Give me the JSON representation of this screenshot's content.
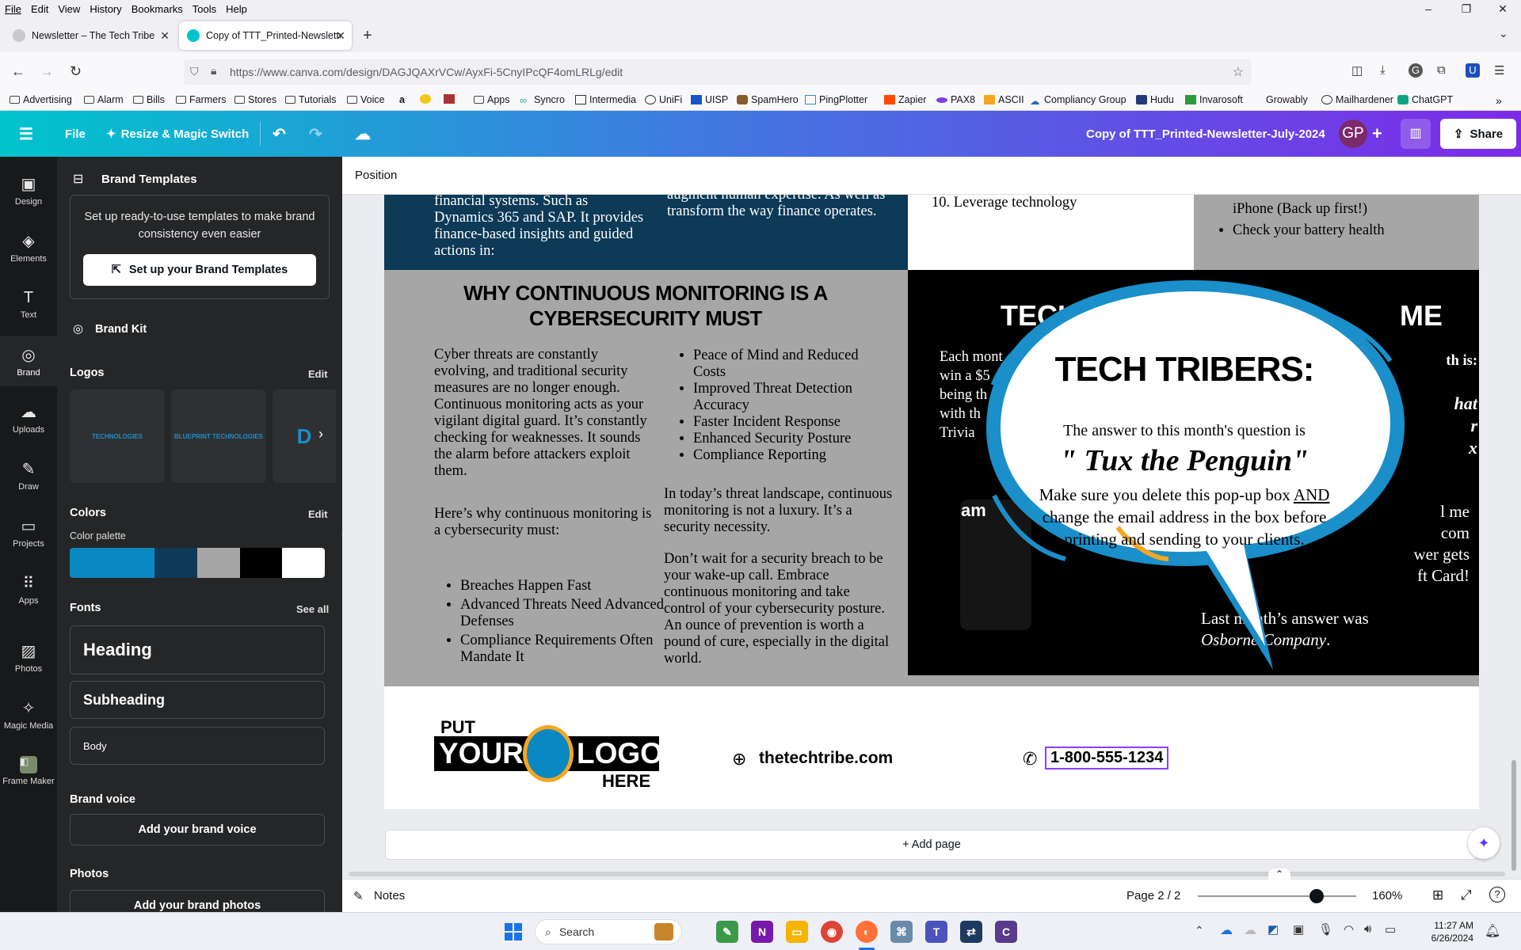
{
  "menu": [
    "File",
    "Edit",
    "View",
    "History",
    "Bookmarks",
    "Tools",
    "Help"
  ],
  "window_controls": {
    "minimize": "–",
    "restore": "❐",
    "close": "✕"
  },
  "tabs": [
    {
      "title": "Newsletter – The Tech Tribe",
      "active": false
    },
    {
      "title": "Copy of TTT_Printed-Newslette",
      "active": true
    }
  ],
  "new_tab": "+",
  "url": "https://www.canva.com/design/DAGJQAXrVCw/AyxFi-5CnyIPcQF4omLRLg/edit",
  "bookmarks": [
    "Advertising",
    "Alarm",
    "Bills",
    "Farmers",
    "Stores",
    "Tutorials",
    "Voice",
    "Apps",
    "Syncro",
    "Intermedia",
    "UniFi",
    "UISP",
    "SpamHero",
    "PingPlotter",
    "Zapier",
    "PAX8",
    "ASCII",
    "Compliancy Group",
    "Hudu",
    "Invarosoft",
    "Growably",
    "Mailhardener",
    "ChatGPT"
  ],
  "canva_header": {
    "file": "File",
    "resize": "Resize & Magic Switch",
    "doc_title": "Copy of  TTT_Printed-Newsletter-July-2024",
    "avatar": "GP",
    "share": "Share"
  },
  "rail": [
    {
      "label": "Design",
      "icon": "design-icon"
    },
    {
      "label": "Elements",
      "icon": "elements-icon"
    },
    {
      "label": "Text",
      "icon": "text-icon"
    },
    {
      "label": "Brand",
      "icon": "brand-icon"
    },
    {
      "label": "Uploads",
      "icon": "uploads-icon"
    },
    {
      "label": "Draw",
      "icon": "draw-icon"
    },
    {
      "label": "Projects",
      "icon": "projects-icon"
    },
    {
      "label": "Apps",
      "icon": "apps-icon"
    },
    {
      "label": "Photos",
      "icon": "photos-icon"
    },
    {
      "label": "Magic Media",
      "icon": "magic-media-icon"
    },
    {
      "label": "Frame Maker",
      "icon": "frame-maker-icon"
    }
  ],
  "panel": {
    "title": "Brand Templates",
    "promo_text": "Set up ready-to-use templates to make brand consistency even easier",
    "promo_button": "Set up your Brand Templates",
    "brand_kit": "Brand Kit",
    "logos_title": "Logos",
    "logos_edit": "Edit",
    "logo_texts": [
      "TECHNOLOGIES",
      "BLUEPRINT TECHNOLOGIES",
      "D"
    ],
    "colors_title": "Colors",
    "colors_edit": "Edit",
    "palette_label": "Color palette",
    "palette": [
      "#0a88c2",
      "#0a88c2",
      "#0c3a57",
      "#a6a6a6",
      "#000000",
      "#ffffff"
    ],
    "fonts_title": "Fonts",
    "fonts_see_all": "See all",
    "font_samples": [
      "Heading",
      "Subheading",
      "Body"
    ],
    "brand_voice_title": "Brand voice",
    "brand_voice_button": "Add your brand voice",
    "photos_title": "Photos",
    "photos_button": "Add your brand photos"
  },
  "position_label": "Position",
  "newsletter": {
    "top_col1": "financial systems. Such as Dynamics 365 and SAP. It provides finance-based insights and guided actions in:",
    "top_col2": "augment human expertise. As well as transform the way finance operates.",
    "top_col3": "10. Leverage technology",
    "top_col4": [
      "iPhone (Back up first!)",
      "Check your battery health"
    ],
    "monitoring_heading": "WHY CONTINUOUS MONITORING IS A CYBERSECURITY MUST",
    "monitoring_p1": "Cyber threats are constantly evolving, and traditional security measures are no longer enough. Continuous monitoring acts as your vigilant digital guard. It’s constantly checking for weaknesses. It sounds the alarm before attackers exploit them.",
    "monitoring_p2": "Here’s why continuous monitoring is a cybersecurity must:",
    "monitoring_bullets_left": [
      "Breaches Happen Fast",
      "Advanced Threats Need Advanced Defenses",
      "Compliance Requirements Often Mandate It"
    ],
    "monitoring_bullets_right": [
      "Peace of Mind and Reduced Costs",
      "Improved Threat Detection Accuracy",
      "Faster Incident Response",
      "Enhanced Security Posture",
      "Compliance Reporting"
    ],
    "monitoring_p3": "In today’s threat landscape, continuous monitoring is not a luxury. It’s a security necessity.",
    "monitoring_p4": "Don’t wait for a security breach to be your wake-up call. Embrace continuous monitoring and take control of your cybersecurity posture. An ounce of prevention is worth a pound of cure, especially in the digital world.",
    "trivia_heading_left": "TECH",
    "trivia_heading_right": "ME",
    "trivia_left_lines": [
      "Each mont",
      "win a $5",
      "being th",
      "with th",
      "Trivia"
    ],
    "trivia_right_lines": [
      "th is:",
      "hat",
      "r",
      "x",
      "l me",
      "com",
      "wer gets",
      "ft Card!"
    ],
    "amazon": "am",
    "last_month": "Last month’s answer was",
    "last_answer": "Osborne Company",
    "bubble_title": "TECH TRIBERS:",
    "bubble_line1": "The answer to this month's question is",
    "bubble_answer": "\" Tux the Penguin\"",
    "bubble_line2_pre": "Make sure you delete this pop-up box ",
    "bubble_line2_and": "AND",
    "bubble_line3": "change the email address in  the box before printing and sending to your clients.",
    "logo_put": "PUT",
    "logo_your": "YOUR",
    "logo_logo": "LOGO",
    "logo_here": "HERE",
    "website": "thetechtribe.com",
    "phone": "1-800-555-1234"
  },
  "add_page": "+ Add page",
  "bottom": {
    "notes": "Notes",
    "page": "Page 2 / 2",
    "zoom_level": 0.75,
    "zoom": "160%"
  },
  "taskbar": {
    "search": "Search",
    "time": "11:27 AM",
    "date": "6/26/2024"
  },
  "colors": {
    "canva_teal": "#00c4cc",
    "canva_purple": "#7d2ae8",
    "news_navy": "#0c3a57",
    "news_gray": "#a6a6a6",
    "bubble_blue": "#1a8fc9"
  }
}
